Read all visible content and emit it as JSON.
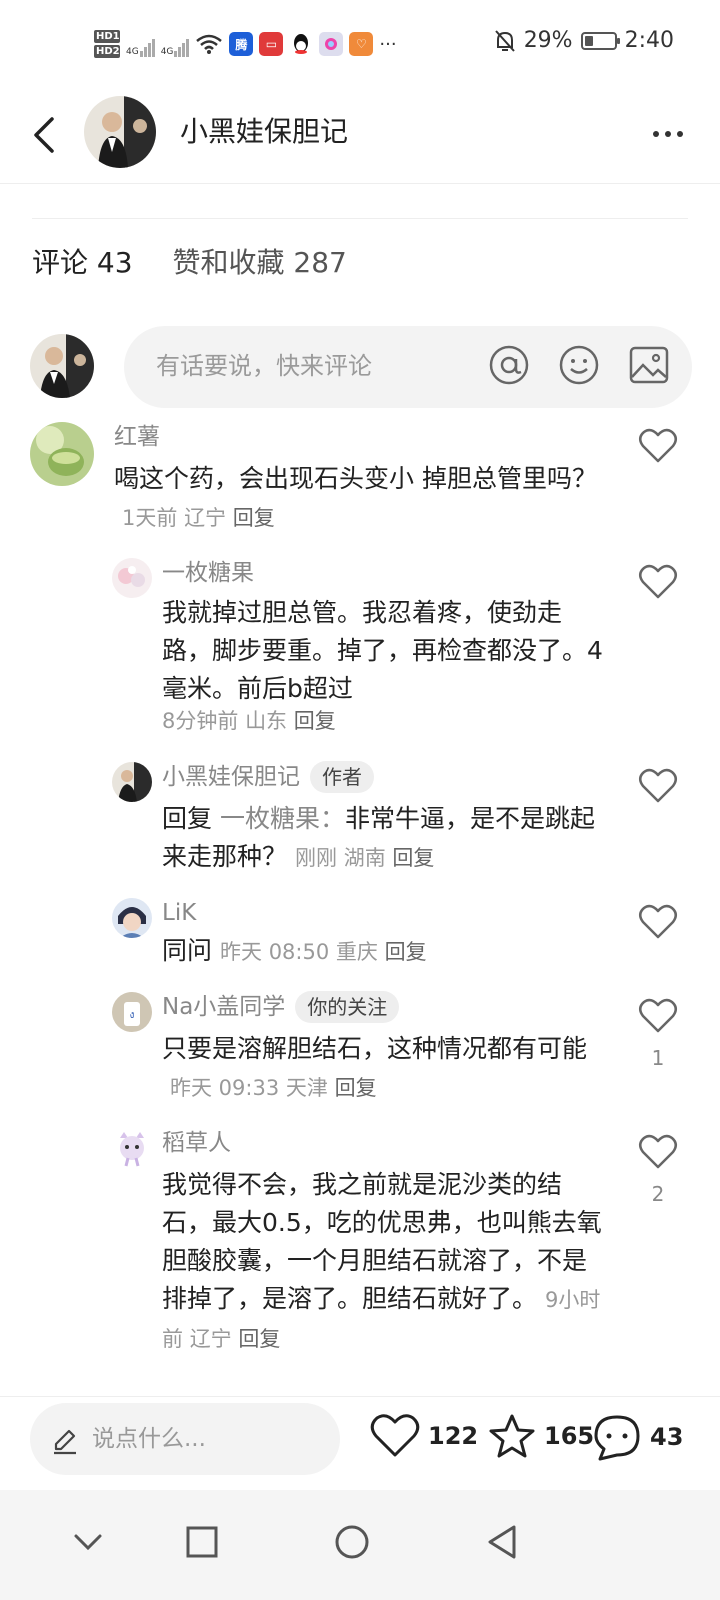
{
  "status_bar": {
    "hd1": "HD",
    "hd1_sub": "1",
    "hd2": "HD",
    "hd2_sub": "2",
    "net1": "4G",
    "net2": "4G",
    "battery": "29%",
    "battery_level": 0.29,
    "time": "2:40",
    "more": "···"
  },
  "header": {
    "title": "小黑娃保胆记"
  },
  "tabs": [
    {
      "label": "评论 43"
    },
    {
      "label": "赞和收藏 287"
    }
  ],
  "comment_input": {
    "placeholder": "有话要说，快来评论"
  },
  "comments": [
    {
      "name": "红薯",
      "text": "喝这个药，会出现石头变小 掉胆总管里吗？",
      "time": "1天前",
      "location": "辽宁",
      "reply": "回复",
      "likes": ""
    },
    {
      "name": "一枚糖果",
      "text": "我就掉过胆总管。我忍着疼，使劲走路，脚步要重。掉了，再检查都没了。4毫米。前后b超过",
      "time": "8分钟前",
      "location": "山东",
      "reply": "回复",
      "likes": ""
    },
    {
      "name": "小黑娃保胆记",
      "badge": "作者",
      "reply_prefix": "回复",
      "reply_to": "一枚糖果：",
      "text": "非常牛逼，是不是跳起来走那种？",
      "time": "刚刚",
      "location": "湖南",
      "reply": "回复",
      "likes": ""
    },
    {
      "name": "LiK",
      "text": "同问",
      "time": "昨天 08:50",
      "location": "重庆",
      "reply": "回复",
      "likes": ""
    },
    {
      "name": "Na小盖同学",
      "badge": "你的关注",
      "text": "只要是溶解胆结石，这种情况都有可能",
      "time": "昨天 09:33",
      "location": "天津",
      "reply": "回复",
      "likes": "1"
    },
    {
      "name": "稻草人",
      "text": "我觉得不会，我之前就是泥沙类的结石，最大0.5，吃的优思弗，也叫熊去氧胆酸胶囊，一个月胆结石就溶了，不是排掉了，是溶了。胆结石就好了。",
      "time": "9小时前",
      "location": "辽宁",
      "reply": "回复",
      "likes": "2"
    }
  ],
  "bottom_bar": {
    "placeholder": "说点什么...",
    "likes": "122",
    "favorites": "165",
    "comments": "43"
  },
  "colors": {
    "text": "#222222",
    "muted": "#999999",
    "input_bg": "#f3f3f3"
  }
}
